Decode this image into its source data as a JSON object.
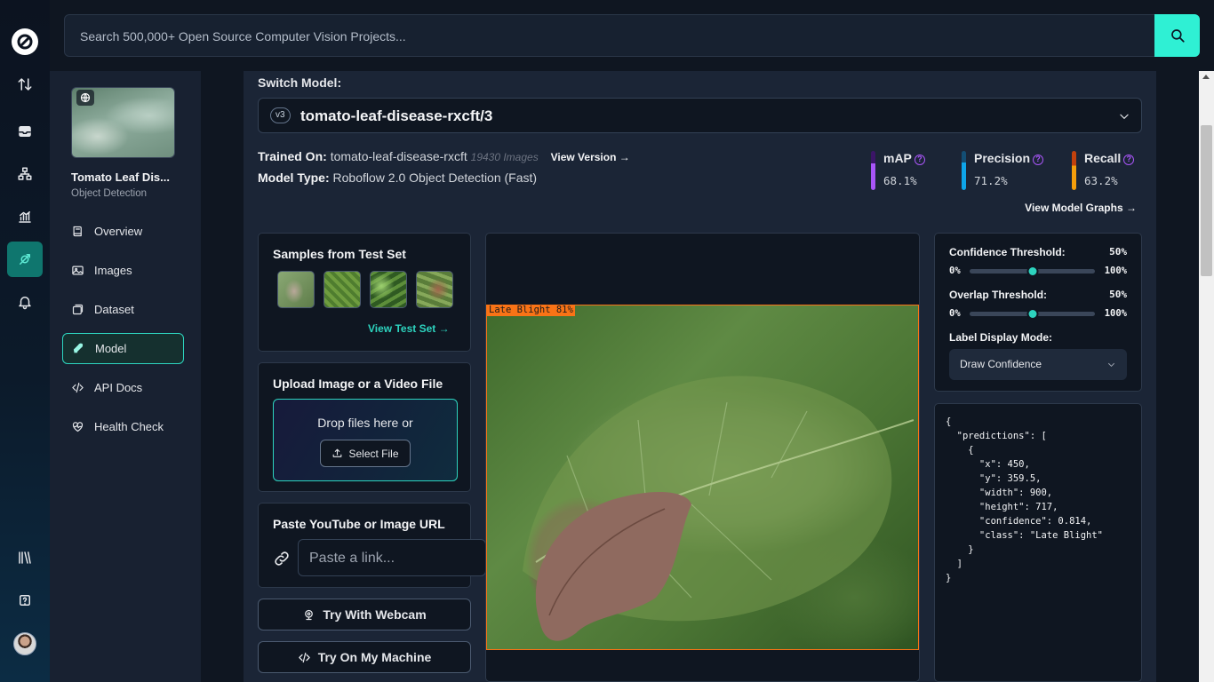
{
  "search": {
    "placeholder": "Search 500,000+ Open Source Computer Vision Projects..."
  },
  "project": {
    "name": "Tomato Leaf Dis...",
    "type": "Object Detection"
  },
  "nav": [
    {
      "label": "Overview",
      "icon": "book-icon"
    },
    {
      "label": "Images",
      "icon": "images-icon"
    },
    {
      "label": "Dataset",
      "icon": "dataset-icon"
    },
    {
      "label": "Model",
      "icon": "rocket-icon",
      "active": true
    },
    {
      "label": "API Docs",
      "icon": "code-icon"
    },
    {
      "label": "Health Check",
      "icon": "heart-pulse-icon"
    }
  ],
  "model": {
    "switch_label": "Switch Model:",
    "version_pill": "v3",
    "selected": "tomato-leaf-disease-rxcft/3",
    "trained_on_label": "Trained On:",
    "trained_on": "tomato-leaf-disease-rxcft",
    "images_count": "19430 Images",
    "view_version": "View Version",
    "model_type_label": "Model Type:",
    "model_type": "Roboflow 2.0 Object Detection (Fast)",
    "view_graphs": "View Model Graphs"
  },
  "metrics": [
    {
      "label": "mAP",
      "value": "68.1%",
      "fraction": 0.681,
      "color": "#a855f7"
    },
    {
      "label": "Precision",
      "value": "71.2%",
      "fraction": 0.712,
      "color": "#0ea5e9"
    },
    {
      "label": "Recall",
      "value": "63.2%",
      "fraction": 0.632,
      "color": "#f59e0b"
    }
  ],
  "samples": {
    "title": "Samples from Test Set",
    "link": "View Test Set"
  },
  "upload": {
    "title": "Upload Image or a Video File",
    "drop_text": "Drop files here or",
    "button": "Select File"
  },
  "url": {
    "title": "Paste YouTube or Image URL",
    "placeholder": "Paste a link..."
  },
  "webcam_button": "Try With Webcam",
  "machine_button": "Try On My Machine",
  "detection": {
    "label": "Late Blight 81%"
  },
  "settings": {
    "confidence_label": "Confidence Threshold:",
    "confidence_value": "50%",
    "confidence_fraction": 0.5,
    "overlap_label": "Overlap Threshold:",
    "overlap_value": "50%",
    "overlap_fraction": 0.5,
    "min": "0%",
    "max": "100%",
    "display_mode_label": "Label Display Mode:",
    "display_mode": "Draw Confidence"
  },
  "json_output": "{\n  \"predictions\": [\n    {\n      \"x\": 450,\n      \"y\": 359.5,\n      \"width\": 900,\n      \"height\": 717,\n      \"confidence\": 0.814,\n      \"class\": \"Late Blight\"\n    }\n  ]\n}"
}
